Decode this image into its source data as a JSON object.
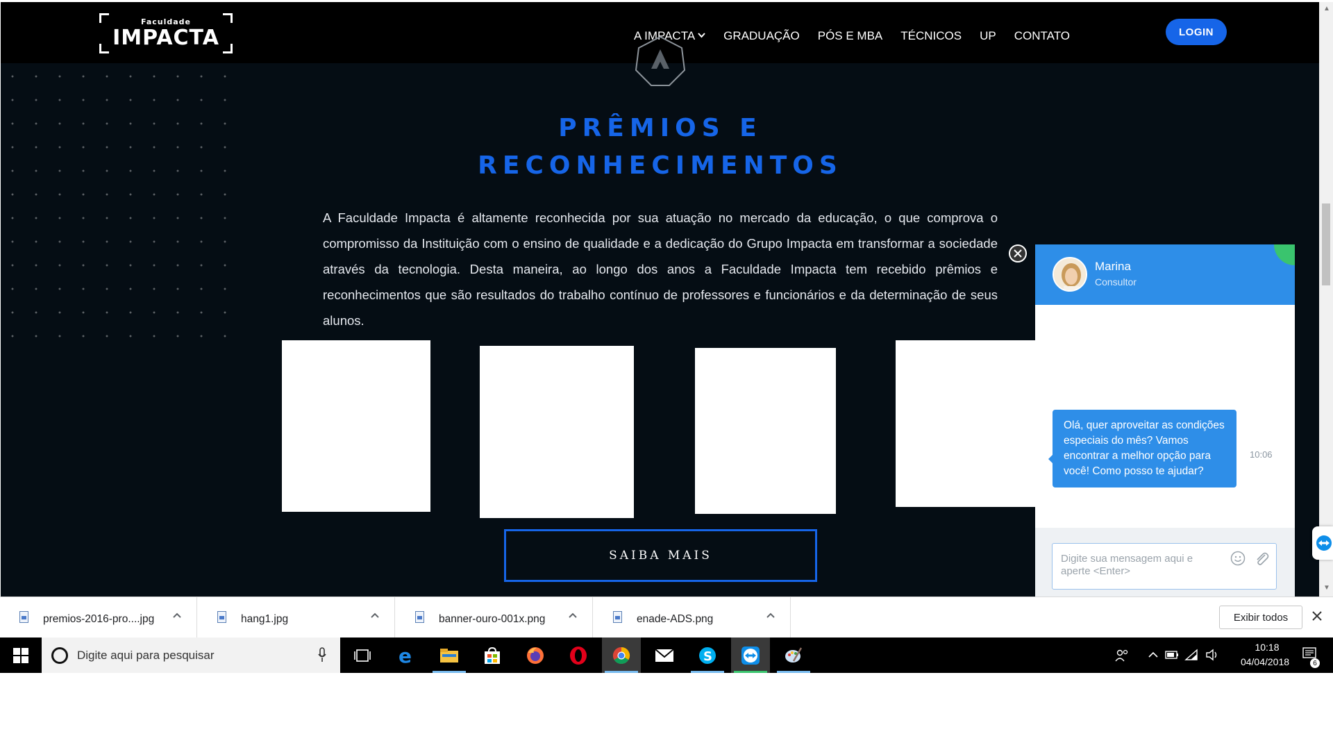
{
  "site": {
    "logo_small": "Faculdade",
    "logo_big": "IMPACTA",
    "nav": [
      {
        "label": "A IMPACTA",
        "has_dropdown": true
      },
      {
        "label": "GRADUAÇÃO"
      },
      {
        "label": "PÓS E MBA"
      },
      {
        "label": "TÉCNICOS"
      },
      {
        "label": "UP"
      },
      {
        "label": "CONTATO"
      }
    ],
    "login_label": "LOGIN",
    "section_title_line1": "PRÊMIOS E",
    "section_title_line2": "RECONHECIMENTOS",
    "section_text": "A Faculdade Impacta é altamente reconhecida por sua atuação no mercado da educação, o que comprova o compromisso da Instituição com o ensino de qualidade e a dedicação do Grupo Impacta em transformar a sociedade através da tecnologia. Desta maneira, ao longo dos anos a Faculdade Impacta tem recebido prêmios e reconhecimentos que são resultados do trabalho contínuo de professores e funcionários e da determinação de seus alunos.",
    "saiba_mais_label": "SAIBA MAIS",
    "colors": {
      "accent": "#1665e8",
      "background": "#050d14",
      "navbar": "#000000"
    }
  },
  "chat": {
    "agent_name": "Marina",
    "agent_role": "Consultor",
    "message": "Olá, quer aproveitar as condições especiais do mês? Vamos encontrar a melhor opção para você! Como posso te ajudar?",
    "message_time": "10:06",
    "input_placeholder": "Digite sua mensagem aqui e aperte <Enter>",
    "colors": {
      "header": "#2e8ee8",
      "bubble": "#2e8ee8",
      "corner": "#3ac46e"
    }
  },
  "downloads": {
    "items": [
      {
        "name": "premios-2016-pro....jpg"
      },
      {
        "name": "hang1.jpg"
      },
      {
        "name": "banner-ouro-001x.png"
      },
      {
        "name": "enade-ADS.png"
      }
    ],
    "show_all_label": "Exibir todos"
  },
  "taskbar": {
    "search_placeholder": "Digite aqui para pesquisar",
    "apps": [
      "task-view-icon",
      "edge-icon",
      "file-explorer-icon",
      "store-icon",
      "firefox-icon",
      "opera-icon",
      "chrome-icon",
      "mail-icon",
      "skype-icon",
      "teamviewer-icon",
      "paint-icon"
    ],
    "clock_time": "10:18",
    "clock_date": "04/04/2018",
    "notification_count": "6"
  }
}
